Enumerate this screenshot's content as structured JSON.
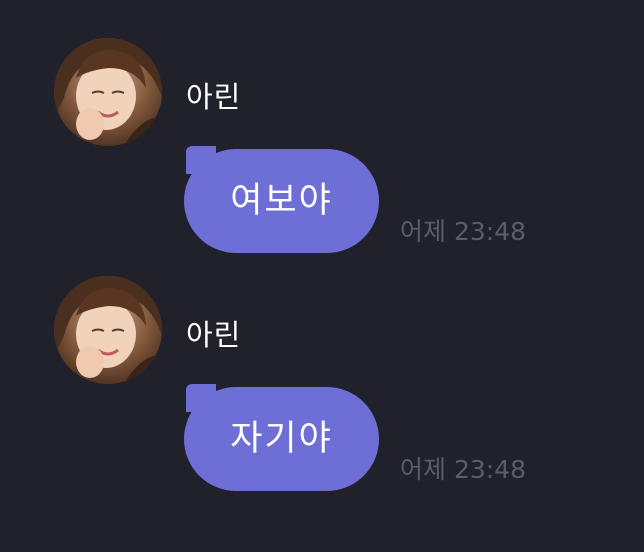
{
  "messages": [
    {
      "sender": "아린",
      "text": "여보야",
      "time": "어제 23:48"
    },
    {
      "sender": "아린",
      "text": "자기야",
      "time": "어제 23:48"
    }
  ],
  "colors": {
    "background": "#21212b",
    "bubble": "#6e6fd6",
    "timestamp": "#5c5c68",
    "sender_text": "#ffffff"
  },
  "icons": {
    "avatar": "profile-photo"
  }
}
